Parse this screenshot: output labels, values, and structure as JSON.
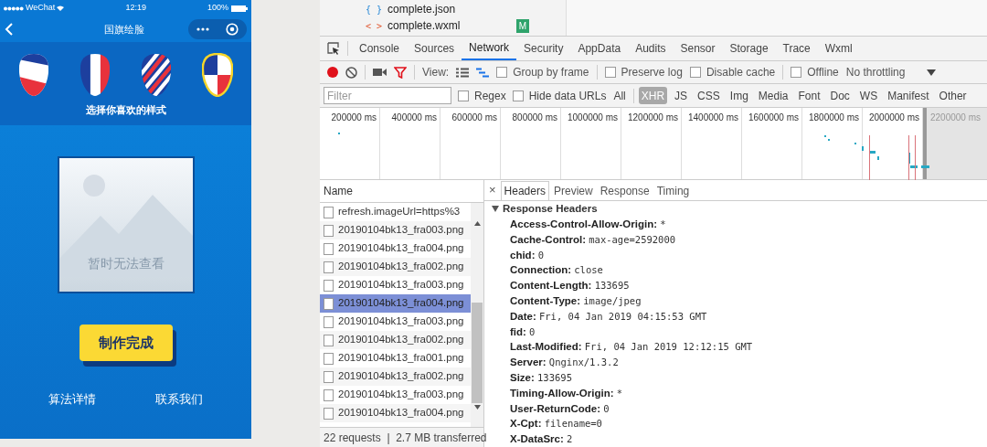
{
  "phone": {
    "status_bar": {
      "carrier": "WeChat",
      "time": "12:19",
      "battery": "100%"
    },
    "nav_title": "国旗绘脸",
    "styles": [
      {
        "kind": "diagonal"
      },
      {
        "kind": "vertical"
      },
      {
        "kind": "stripes"
      },
      {
        "kind": "quarters"
      }
    ],
    "styles_caption": "选择你喜欢的样式",
    "placeholder_text": "暂时无法查看",
    "done_button": "制作完成",
    "links": [
      "算法详情",
      "联系我们"
    ]
  },
  "files": [
    {
      "icon": "{ }",
      "name": "complete.json"
    },
    {
      "icon": "< >",
      "name": "complete.wxml",
      "badge": "M"
    }
  ],
  "devtools": {
    "tabs": [
      {
        "label": "Console",
        "selected": false
      },
      {
        "label": "Sources",
        "selected": false
      },
      {
        "label": "Network",
        "selected": true
      },
      {
        "label": "Security",
        "selected": false
      },
      {
        "label": "AppData",
        "selected": false
      },
      {
        "label": "Audits",
        "selected": false
      },
      {
        "label": "Sensor",
        "selected": false
      },
      {
        "label": "Storage",
        "selected": false
      },
      {
        "label": "Trace",
        "selected": false
      },
      {
        "label": "Wxml",
        "selected": false
      }
    ],
    "toolbar": {
      "recording": true,
      "view_label": "View:",
      "checkboxes": [
        {
          "label": "Group by frame",
          "checked": false
        },
        {
          "label": "Preserve log",
          "checked": false
        },
        {
          "label": "Disable cache",
          "checked": false
        },
        {
          "label": "Offline",
          "checked": false
        }
      ],
      "throttling": "No throttling"
    },
    "filter": {
      "placeholder": "Filter",
      "options": [
        {
          "label": "Regex",
          "checked": false
        },
        {
          "label": "Hide data URLs",
          "checked": false
        }
      ],
      "types": [
        {
          "label": "All",
          "selected": false
        },
        {
          "label": "XHR",
          "selected": true
        },
        {
          "label": "JS",
          "selected": false
        },
        {
          "label": "CSS",
          "selected": false
        },
        {
          "label": "Img",
          "selected": false
        },
        {
          "label": "Media",
          "selected": false
        },
        {
          "label": "Font",
          "selected": false
        },
        {
          "label": "Doc",
          "selected": false
        },
        {
          "label": "WS",
          "selected": false
        },
        {
          "label": "Manifest",
          "selected": false
        },
        {
          "label": "Other",
          "selected": false
        }
      ]
    },
    "timeline": {
      "ticks": [
        "200000 ms",
        "400000 ms",
        "600000 ms",
        "800000 ms",
        "1000000 ms",
        "1200000 ms",
        "1400000 ms",
        "1600000 ms",
        "1800000 ms",
        "2000000 ms"
      ],
      "outside_tick": "2200000 ms"
    },
    "requests": {
      "column": "Name",
      "rows": [
        {
          "name": "refresh.imageUrl=https%3",
          "selected": false
        },
        {
          "name": "20190104bk13_fra003.png",
          "selected": false
        },
        {
          "name": "20190104bk13_fra004.png",
          "selected": false
        },
        {
          "name": "20190104bk13_fra002.png",
          "selected": false
        },
        {
          "name": "20190104bk13_fra003.png",
          "selected": false
        },
        {
          "name": "20190104bk13_fra004.png",
          "selected": true
        },
        {
          "name": "20190104bk13_fra003.png",
          "selected": false
        },
        {
          "name": "20190104bk13_fra002.png",
          "selected": false
        },
        {
          "name": "20190104bk13_fra001.png",
          "selected": false
        },
        {
          "name": "20190104bk13_fra002.png",
          "selected": false
        },
        {
          "name": "20190104bk13_fra003.png",
          "selected": false
        },
        {
          "name": "20190104bk13_fra004.png",
          "selected": false
        }
      ],
      "summary": "22 requests  |  2.7 MB transferred"
    },
    "details": {
      "close": "×",
      "tabs": [
        {
          "label": "Headers",
          "selected": true
        },
        {
          "label": "Preview",
          "selected": false
        },
        {
          "label": "Response",
          "selected": false
        },
        {
          "label": "Timing",
          "selected": false
        }
      ],
      "section": {
        "title": "Response Headers",
        "expanded": true
      },
      "headers": [
        {
          "name": "Access-Control-Allow-Origin:",
          "value": "*"
        },
        {
          "name": "Cache-Control:",
          "value": "max-age=2592000"
        },
        {
          "name": "chid:",
          "value": "0"
        },
        {
          "name": "Connection:",
          "value": "close"
        },
        {
          "name": "Content-Length:",
          "value": "133695"
        },
        {
          "name": "Content-Type:",
          "value": "image/jpeg"
        },
        {
          "name": "Date:",
          "value": "Fri, 04 Jan 2019 04:15:53 GMT"
        },
        {
          "name": "fid:",
          "value": "0"
        },
        {
          "name": "Last-Modified:",
          "value": "Fri, 04 Jan 2019 12:12:15 GMT"
        },
        {
          "name": "Server:",
          "value": "Qnginx/1.3.2"
        },
        {
          "name": "Size:",
          "value": "133695"
        },
        {
          "name": "Timing-Allow-Origin:",
          "value": "*"
        },
        {
          "name": "User-ReturnCode:",
          "value": "0"
        },
        {
          "name": "X-Cpt:",
          "value": "filename=0"
        },
        {
          "name": "X-DataSrc:",
          "value": "2"
        }
      ]
    }
  }
}
